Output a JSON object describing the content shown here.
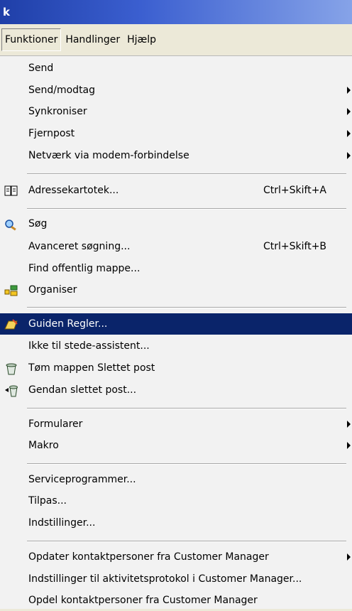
{
  "window": {
    "title": "k"
  },
  "menubar": {
    "items": [
      "Funktioner",
      "Handlinger",
      "Hjælp"
    ]
  },
  "menu": {
    "send": "Send",
    "send_receive": "Send/modtag",
    "synchronize": "Synkroniser",
    "remote_mail": "Fjernpost",
    "dialup": "Netværk via modem-forbindelse",
    "address_book": "Adressekartotek...",
    "address_book_shortcut": "Ctrl+Skift+A",
    "search": "Søg",
    "advanced_search": "Avanceret søgning...",
    "advanced_search_shortcut": "Ctrl+Skift+B",
    "find_public_folder": "Find offentlig mappe...",
    "organize": "Organiser",
    "rules_wizard": "Guiden Regler...",
    "out_of_office": "Ikke til stede-assistent...",
    "empty_deleted": "Tøm mappen Slettet post",
    "recover_deleted": "Gendan slettet post...",
    "forms": "Formularer",
    "macro": "Makro",
    "tools": "Serviceprogrammer...",
    "customize": "Tilpas...",
    "options": "Indstillinger...",
    "update_contacts": "Opdater kontaktpersoner fra Customer Manager",
    "activity_log_settings": "Indstillinger til aktivitetsprotokol i Customer Manager...",
    "share_contacts": "Opdel kontaktpersoner fra Customer Manager"
  },
  "colors": {
    "highlight": "#0a246a",
    "menu_bg": "#f2f2f2",
    "titlebar": "#1f3fa8"
  }
}
